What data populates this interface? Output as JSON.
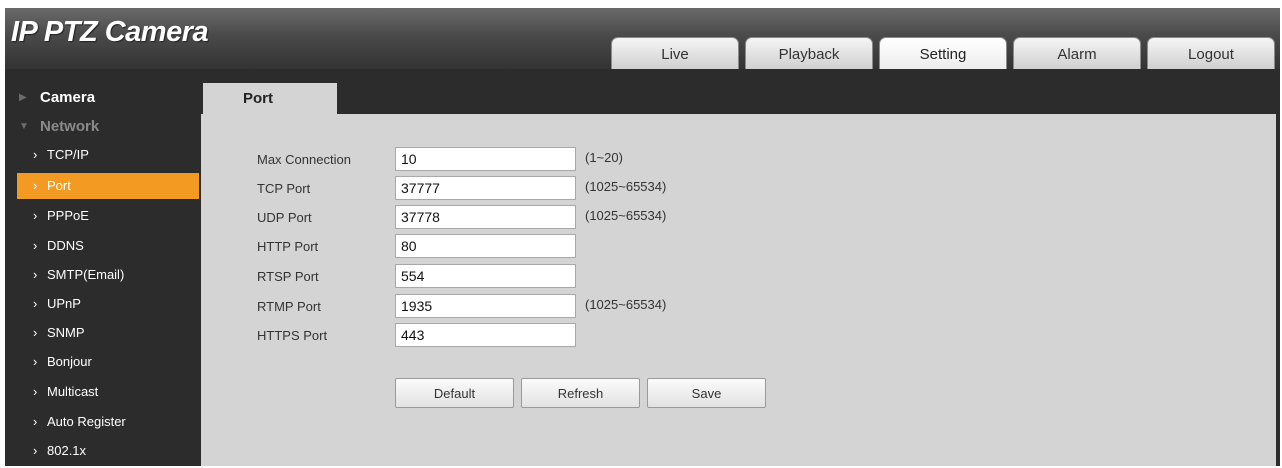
{
  "app": {
    "title": "IP PTZ Camera"
  },
  "nav": {
    "tabs": [
      {
        "label": "Live"
      },
      {
        "label": "Playback"
      },
      {
        "label": "Setting"
      },
      {
        "label": "Alarm"
      },
      {
        "label": "Logout"
      }
    ],
    "active_tab": "Setting"
  },
  "sidebar": {
    "sections": [
      {
        "label": "Camera",
        "expanded": false,
        "icon": "triangle-right-icon"
      },
      {
        "label": "Network",
        "expanded": true,
        "icon": "triangle-down-icon"
      }
    ],
    "items": [
      {
        "label": "TCP/IP"
      },
      {
        "label": "Port"
      },
      {
        "label": "PPPoE"
      },
      {
        "label": "DDNS"
      },
      {
        "label": "SMTP(Email)"
      },
      {
        "label": "UPnP"
      },
      {
        "label": "SNMP"
      },
      {
        "label": "Bonjour"
      },
      {
        "label": "Multicast"
      },
      {
        "label": "Auto Register"
      },
      {
        "label": "802.1x"
      }
    ],
    "active_item": "Port"
  },
  "page": {
    "title": "Port"
  },
  "form": {
    "fields": [
      {
        "label": "Max Connection",
        "value": "10",
        "range": "(1~20)"
      },
      {
        "label": "TCP Port",
        "value": "37777",
        "range": "(1025~65534)"
      },
      {
        "label": "UDP Port",
        "value": "37778",
        "range": "(1025~65534)"
      },
      {
        "label": "HTTP Port",
        "value": "80",
        "range": ""
      },
      {
        "label": "RTSP Port",
        "value": "554",
        "range": ""
      },
      {
        "label": "RTMP Port",
        "value": "1935",
        "range": "(1025~65534)"
      },
      {
        "label": "HTTPS Port",
        "value": "443",
        "range": ""
      }
    ],
    "buttons": {
      "default": "Default",
      "refresh": "Refresh",
      "save": "Save"
    }
  },
  "colors": {
    "accent": "#f39a23",
    "sidebar_bg": "#2c2c2c",
    "content_bg": "#d4d4d4"
  }
}
